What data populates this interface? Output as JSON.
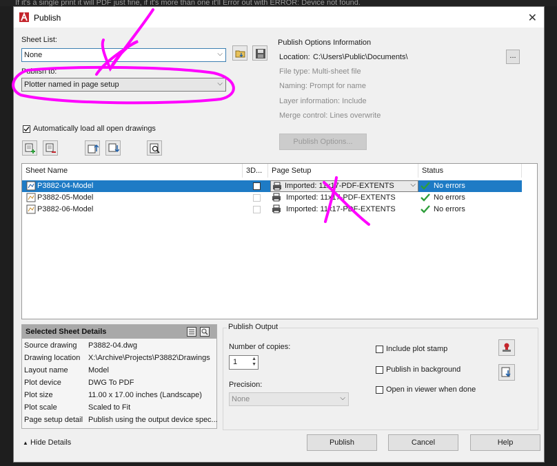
{
  "top_caption": "If it's a single print it will PDF just fine, if it's more than one it'll Error out with ERROR: Device not found.",
  "window": {
    "title": "Publish",
    "close_glyph": "✕"
  },
  "sheet_list": {
    "label": "Sheet List:",
    "value": "None"
  },
  "publish_to": {
    "label": "Publish to:",
    "value": "Plotter named in page setup"
  },
  "publish_options_info": {
    "title": "Publish Options Information",
    "location_label": "Location:",
    "location_value": "C:\\Users\\Public\\Documents\\",
    "browse_label": "...",
    "file_type": "File type: Multi-sheet file",
    "naming": "Naming: Prompt for name",
    "layer_info": "Layer information: Include",
    "merge_control": "Merge control: Lines overwrite",
    "options_button": "Publish Options..."
  },
  "auto_load": {
    "label": "Automatically load all open drawings",
    "checked": true
  },
  "grid": {
    "columns": [
      "Sheet Name",
      "3D...",
      "Page Setup",
      "Status"
    ],
    "rows": [
      {
        "name": "P3882-04-Model",
        "page_setup": "Imported: 11x17-PDF-EXTENTS",
        "status": "No errors",
        "selected": true
      },
      {
        "name": "P3882-05-Model",
        "page_setup": "Imported: 11x17-PDF-EXTENTS",
        "status": "No errors",
        "selected": false
      },
      {
        "name": "P3882-06-Model",
        "page_setup": "Imported: 11x17-PDF-EXTENTS",
        "status": "No errors",
        "selected": false
      }
    ]
  },
  "selected_details": {
    "title": "Selected Sheet Details",
    "rows": [
      {
        "key": "Source drawing",
        "value": "P3882-04.dwg"
      },
      {
        "key": "Drawing location",
        "value": "X:\\Archive\\Projects\\P3882\\Drawings"
      },
      {
        "key": "Layout name",
        "value": "Model"
      },
      {
        "key": "Plot device",
        "value": "DWG To PDF"
      },
      {
        "key": "Plot size",
        "value": "11.00 x 17.00 inches (Landscape)"
      },
      {
        "key": "Plot scale",
        "value": "Scaled to Fit"
      },
      {
        "key": "Page setup detail",
        "value": "Publish using the output device spec..."
      }
    ]
  },
  "publish_output": {
    "title": "Publish Output",
    "copies_label": "Number of copies:",
    "copies_value": "1",
    "precision_label": "Precision:",
    "precision_value": "None",
    "include_stamp": "Include plot stamp",
    "publish_background": "Publish in background",
    "open_viewer": "Open in viewer when done"
  },
  "footer": {
    "hide_details": "Hide Details",
    "publish": "Publish",
    "cancel": "Cancel",
    "help": "Help"
  },
  "colors": {
    "selection": "#1e7bc5",
    "annotation": "#ff00ff",
    "status_ok": "#2e9e3a"
  }
}
